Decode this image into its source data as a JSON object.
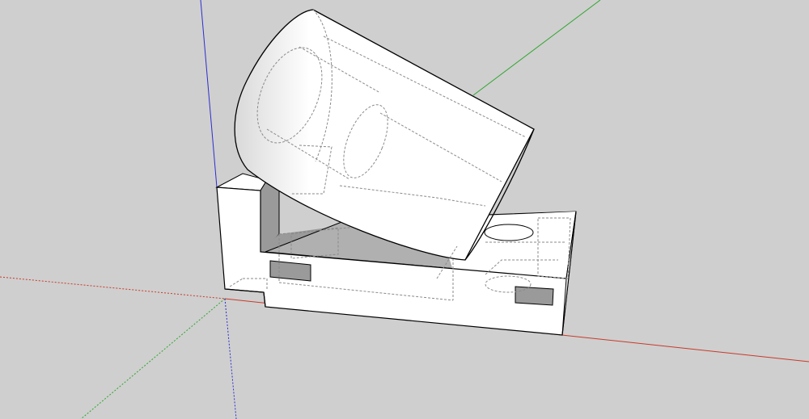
{
  "app": {
    "name": "",
    "view": "3d-viewport"
  },
  "colors": {
    "background": "#cfcfcf",
    "axis_red": "#c83a2a",
    "axis_green": "#2fa52f",
    "axis_blue": "#2d2dcf",
    "model_face": "#ffffff",
    "model_shade": "#9a9a9a",
    "model_edge": "#000000",
    "hidden_edge": "#8a8a8a"
  },
  "scene": {
    "axes": [
      "red-axis",
      "green-axis",
      "blue-axis"
    ],
    "model": {
      "parts": [
        "base-block",
        "cylinder",
        "mounting-hole",
        "slot-left",
        "slot-right"
      ],
      "hidden_lines": "dashed"
    }
  }
}
